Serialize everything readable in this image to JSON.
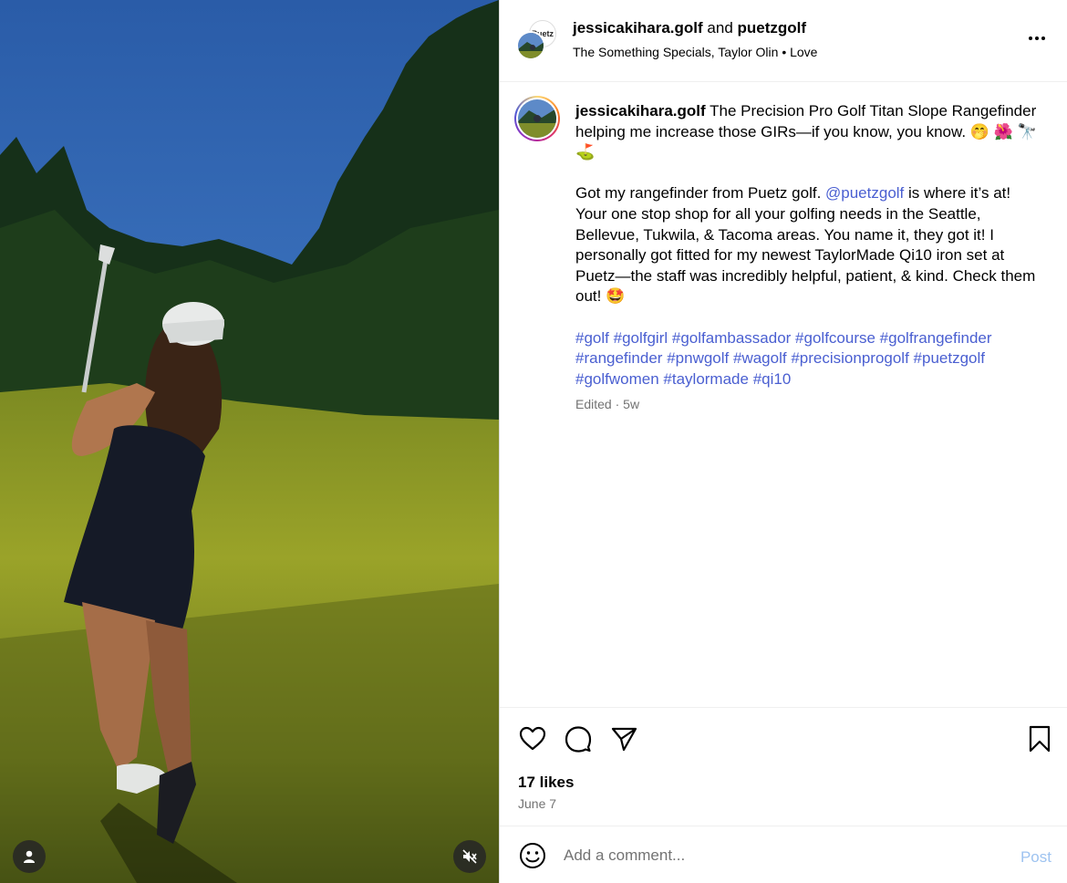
{
  "header": {
    "author": "jessicakihara.golf",
    "joiner": "and",
    "collaborator": "puetzgolf",
    "collaborator_avatar_text": "Puetz",
    "audio": "The Something Specials, Taylor Olin",
    "audio_sep": "•",
    "audio_track": "Love",
    "more_icon": "more-horizontal-icon"
  },
  "caption": {
    "username": "jessicakihara.golf",
    "line1": "The Precision Pro Golf Titan Slope Rangefinder helping me increase those GIRs—if you know, you know. 🤭 🌺 🔭 ⛳",
    "p2_before": "Got my rangefinder from Puetz golf. ",
    "p2_mention": "@puetzgolf",
    "p2_after": " is where it’s at! Your one stop shop for all your golfing needs in the Seattle, Bellevue, Tukwila, & Tacoma areas. You name it, they got it! I personally got fitted for my newest TaylorMade Qi10 iron set at Puetz—the staff was incredibly helpful, patient, & kind. Check them out! 🤩",
    "hashtags": [
      "#golf",
      "#golfgirl",
      "#golfambassador",
      "#golfcourse",
      "#golfrangefinder",
      "#rangefinder",
      "#pnwgolf",
      "#wagolf",
      "#precisionprogolf",
      "#puetzgolf",
      "#golfwomen",
      "#taylormade",
      "#qi10"
    ],
    "edited": "Edited",
    "meta_sep": "·",
    "age": "5w"
  },
  "actions": {
    "likes": "17 likes",
    "date": "June 7"
  },
  "comment": {
    "placeholder": "Add a comment...",
    "post_label": "Post"
  },
  "colors": {
    "link": "#4a5fd1",
    "post_disabled": "#9ec3f0",
    "muted": "#737373"
  }
}
